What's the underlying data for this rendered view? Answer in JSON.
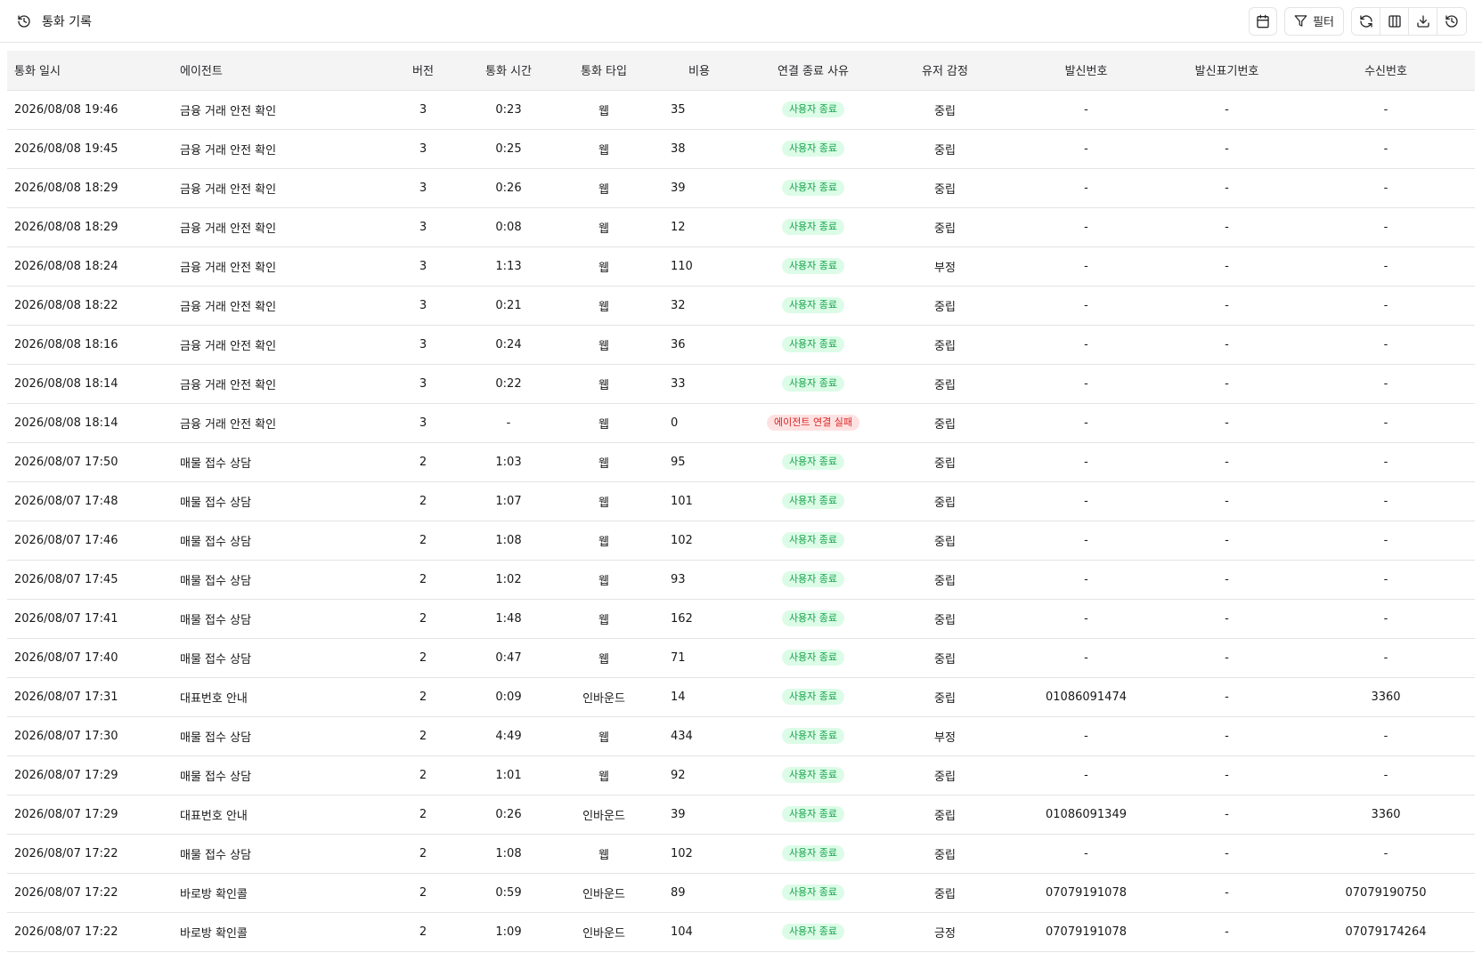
{
  "header": {
    "title": "통화 기록",
    "title_icon": "history-icon",
    "filter_label": "필터"
  },
  "table": {
    "columns": [
      "통화 일시",
      "에이전트",
      "버전",
      "통화 시간",
      "통화 타입",
      "비용",
      "연결 종료 사유",
      "유저 감정",
      "발신번호",
      "발신표기번호",
      "수신번호"
    ],
    "rows": [
      {
        "datetime": "2026/08/08 19:46",
        "agent": "금융 거래 안전 확인",
        "version": "3",
        "duration": "0:23",
        "type": "웹",
        "cost": "35",
        "reason": "사용자 종료",
        "reason_status": "ok",
        "sentiment": "중립",
        "caller": "-",
        "caller_display": "-",
        "callee": "-"
      },
      {
        "datetime": "2026/08/08 19:45",
        "agent": "금융 거래 안전 확인",
        "version": "3",
        "duration": "0:25",
        "type": "웹",
        "cost": "38",
        "reason": "사용자 종료",
        "reason_status": "ok",
        "sentiment": "중립",
        "caller": "-",
        "caller_display": "-",
        "callee": "-"
      },
      {
        "datetime": "2026/08/08 18:29",
        "agent": "금융 거래 안전 확인",
        "version": "3",
        "duration": "0:26",
        "type": "웹",
        "cost": "39",
        "reason": "사용자 종료",
        "reason_status": "ok",
        "sentiment": "중립",
        "caller": "-",
        "caller_display": "-",
        "callee": "-"
      },
      {
        "datetime": "2026/08/08 18:29",
        "agent": "금융 거래 안전 확인",
        "version": "3",
        "duration": "0:08",
        "type": "웹",
        "cost": "12",
        "reason": "사용자 종료",
        "reason_status": "ok",
        "sentiment": "중립",
        "caller": "-",
        "caller_display": "-",
        "callee": "-"
      },
      {
        "datetime": "2026/08/08 18:24",
        "agent": "금융 거래 안전 확인",
        "version": "3",
        "duration": "1:13",
        "type": "웹",
        "cost": "110",
        "reason": "사용자 종료",
        "reason_status": "ok",
        "sentiment": "부정",
        "caller": "-",
        "caller_display": "-",
        "callee": "-"
      },
      {
        "datetime": "2026/08/08 18:22",
        "agent": "금융 거래 안전 확인",
        "version": "3",
        "duration": "0:21",
        "type": "웹",
        "cost": "32",
        "reason": "사용자 종료",
        "reason_status": "ok",
        "sentiment": "중립",
        "caller": "-",
        "caller_display": "-",
        "callee": "-"
      },
      {
        "datetime": "2026/08/08 18:16",
        "agent": "금융 거래 안전 확인",
        "version": "3",
        "duration": "0:24",
        "type": "웹",
        "cost": "36",
        "reason": "사용자 종료",
        "reason_status": "ok",
        "sentiment": "중립",
        "caller": "-",
        "caller_display": "-",
        "callee": "-"
      },
      {
        "datetime": "2026/08/08 18:14",
        "agent": "금융 거래 안전 확인",
        "version": "3",
        "duration": "0:22",
        "type": "웹",
        "cost": "33",
        "reason": "사용자 종료",
        "reason_status": "ok",
        "sentiment": "중립",
        "caller": "-",
        "caller_display": "-",
        "callee": "-"
      },
      {
        "datetime": "2026/08/08 18:14",
        "agent": "금융 거래 안전 확인",
        "version": "3",
        "duration": "-",
        "type": "웹",
        "cost": "0",
        "reason": "에이전트 연결 실패",
        "reason_status": "fail",
        "sentiment": "중립",
        "caller": "-",
        "caller_display": "-",
        "callee": "-"
      },
      {
        "datetime": "2026/08/07 17:50",
        "agent": "매물 접수 상담",
        "version": "2",
        "duration": "1:03",
        "type": "웹",
        "cost": "95",
        "reason": "사용자 종료",
        "reason_status": "ok",
        "sentiment": "중립",
        "caller": "-",
        "caller_display": "-",
        "callee": "-"
      },
      {
        "datetime": "2026/08/07 17:48",
        "agent": "매물 접수 상담",
        "version": "2",
        "duration": "1:07",
        "type": "웹",
        "cost": "101",
        "reason": "사용자 종료",
        "reason_status": "ok",
        "sentiment": "중립",
        "caller": "-",
        "caller_display": "-",
        "callee": "-"
      },
      {
        "datetime": "2026/08/07 17:46",
        "agent": "매물 접수 상담",
        "version": "2",
        "duration": "1:08",
        "type": "웹",
        "cost": "102",
        "reason": "사용자 종료",
        "reason_status": "ok",
        "sentiment": "중립",
        "caller": "-",
        "caller_display": "-",
        "callee": "-"
      },
      {
        "datetime": "2026/08/07 17:45",
        "agent": "매물 접수 상담",
        "version": "2",
        "duration": "1:02",
        "type": "웹",
        "cost": "93",
        "reason": "사용자 종료",
        "reason_status": "ok",
        "sentiment": "중립",
        "caller": "-",
        "caller_display": "-",
        "callee": "-"
      },
      {
        "datetime": "2026/08/07 17:41",
        "agent": "매물 접수 상담",
        "version": "2",
        "duration": "1:48",
        "type": "웹",
        "cost": "162",
        "reason": "사용자 종료",
        "reason_status": "ok",
        "sentiment": "중립",
        "caller": "-",
        "caller_display": "-",
        "callee": "-"
      },
      {
        "datetime": "2026/08/07 17:40",
        "agent": "매물 접수 상담",
        "version": "2",
        "duration": "0:47",
        "type": "웹",
        "cost": "71",
        "reason": "사용자 종료",
        "reason_status": "ok",
        "sentiment": "중립",
        "caller": "-",
        "caller_display": "-",
        "callee": "-"
      },
      {
        "datetime": "2026/08/07 17:31",
        "agent": "대표번호 안내",
        "version": "2",
        "duration": "0:09",
        "type": "인바운드",
        "cost": "14",
        "reason": "사용자 종료",
        "reason_status": "ok",
        "sentiment": "중립",
        "caller": "01086091474",
        "caller_display": "-",
        "callee": "3360"
      },
      {
        "datetime": "2026/08/07 17:30",
        "agent": "매물 접수 상담",
        "version": "2",
        "duration": "4:49",
        "type": "웹",
        "cost": "434",
        "reason": "사용자 종료",
        "reason_status": "ok",
        "sentiment": "부정",
        "caller": "-",
        "caller_display": "-",
        "callee": "-"
      },
      {
        "datetime": "2026/08/07 17:29",
        "agent": "매물 접수 상담",
        "version": "2",
        "duration": "1:01",
        "type": "웹",
        "cost": "92",
        "reason": "사용자 종료",
        "reason_status": "ok",
        "sentiment": "중립",
        "caller": "-",
        "caller_display": "-",
        "callee": "-"
      },
      {
        "datetime": "2026/08/07 17:29",
        "agent": "대표번호 안내",
        "version": "2",
        "duration": "0:26",
        "type": "인바운드",
        "cost": "39",
        "reason": "사용자 종료",
        "reason_status": "ok",
        "sentiment": "중립",
        "caller": "01086091349",
        "caller_display": "-",
        "callee": "3360"
      },
      {
        "datetime": "2026/08/07 17:22",
        "agent": "매물 접수 상담",
        "version": "2",
        "duration": "1:08",
        "type": "웹",
        "cost": "102",
        "reason": "사용자 종료",
        "reason_status": "ok",
        "sentiment": "중립",
        "caller": "-",
        "caller_display": "-",
        "callee": "-"
      },
      {
        "datetime": "2026/08/07 17:22",
        "agent": "바로방 확인콜",
        "version": "2",
        "duration": "0:59",
        "type": "인바운드",
        "cost": "89",
        "reason": "사용자 종료",
        "reason_status": "ok",
        "sentiment": "중립",
        "caller": "07079191078",
        "caller_display": "-",
        "callee": "07079190750"
      },
      {
        "datetime": "2026/08/07 17:22",
        "agent": "바로방 확인콜",
        "version": "2",
        "duration": "1:09",
        "type": "인바운드",
        "cost": "104",
        "reason": "사용자 종료",
        "reason_status": "ok",
        "sentiment": "긍정",
        "caller": "07079191078",
        "caller_display": "-",
        "callee": "07079174264"
      }
    ]
  },
  "colors": {
    "badge_ok_bg": "#dcfce7",
    "badge_ok_text": "#16a34a",
    "badge_fail_bg": "#fee2e2",
    "badge_fail_text": "#dc2626",
    "header_bg": "#f4f4f5",
    "border": "#e4e4e7"
  },
  "toolbar_icons": [
    "calendar-icon",
    "filter-icon",
    "refresh-icon",
    "columns-icon",
    "download-icon",
    "history-icon"
  ]
}
